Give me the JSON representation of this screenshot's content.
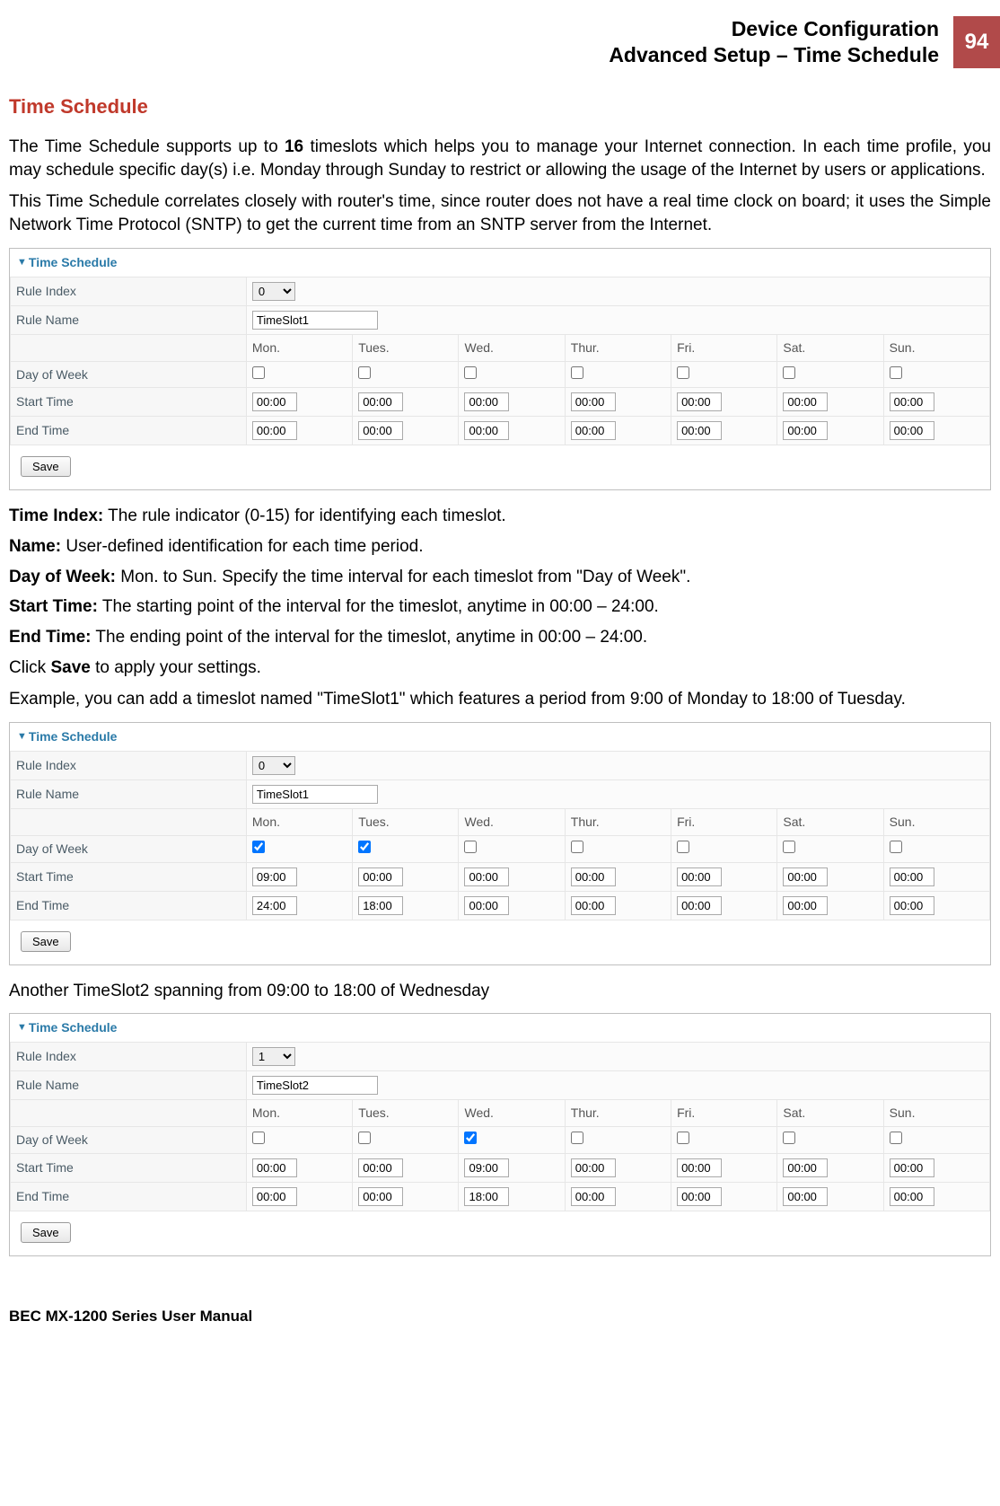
{
  "page": {
    "header_line1": "Device Configuration",
    "header_line2": "Advanced Setup – Time Schedule",
    "number": "94",
    "footer": "BEC MX-1200 Series User Manual"
  },
  "title": "Time Schedule",
  "paras": {
    "intro1_a": "The Time Schedule supports up to ",
    "intro1_b": "16",
    "intro1_c": " timeslots which helps you to manage your Internet connection. In each time profile, you may schedule specific day(s) i.e. Monday through Sunday to restrict or allowing the usage of the Internet by users or applications.",
    "intro2": "This Time Schedule correlates closely with router's time, since router does not have a real time clock on board; it uses the Simple Network Time Protocol (SNTP) to get the current time from an SNTP server from the Internet.",
    "example1": "Example, you can add a timeslot named \"TimeSlot1\" which features a period from 9:00 of Monday to 18:00 of Tuesday.",
    "example2": "Another TimeSlot2 spanning from 09:00 to 18:00 of Wednesday"
  },
  "defs": {
    "time_index_k": "Time Index:",
    "time_index_v": " The rule indicator (0-15) for identifying each timeslot.",
    "name_k": "Name:",
    "name_v": " User-defined identification for each time period.",
    "dow_k": "Day of Week:",
    "dow_v": " Mon. to Sun. Specify the time interval for each timeslot from \"Day of Week\".",
    "start_k": "Start Time:",
    "start_v": " The starting point of the interval for the timeslot, anytime in 00:00 – 24:00.",
    "end_k": "End Time:",
    "end_v": " The ending point of the interval for the timeslot, anytime in 00:00 – 24:00.",
    "click_a": "Click ",
    "click_b": "Save",
    "click_c": " to apply your settings."
  },
  "panel": {
    "title": "Time Schedule",
    "labels": {
      "rule_index": "Rule Index",
      "rule_name": "Rule Name",
      "dow": "Day of Week",
      "start": "Start Time",
      "end": "End Time",
      "save": "Save"
    },
    "days": [
      "Mon.",
      "Tues.",
      "Wed.",
      "Thur.",
      "Fri.",
      "Sat.",
      "Sun."
    ]
  },
  "panels": [
    {
      "rule_index": "0",
      "rule_name": "TimeSlot1",
      "checked": [
        false,
        false,
        false,
        false,
        false,
        false,
        false
      ],
      "start": [
        "00:00",
        "00:00",
        "00:00",
        "00:00",
        "00:00",
        "00:00",
        "00:00"
      ],
      "end": [
        "00:00",
        "00:00",
        "00:00",
        "00:00",
        "00:00",
        "00:00",
        "00:00"
      ]
    },
    {
      "rule_index": "0",
      "rule_name": "TimeSlot1",
      "checked": [
        true,
        true,
        false,
        false,
        false,
        false,
        false
      ],
      "start": [
        "09:00",
        "00:00",
        "00:00",
        "00:00",
        "00:00",
        "00:00",
        "00:00"
      ],
      "end": [
        "24:00",
        "18:00",
        "00:00",
        "00:00",
        "00:00",
        "00:00",
        "00:00"
      ]
    },
    {
      "rule_index": "1",
      "rule_name": "TimeSlot2",
      "checked": [
        false,
        false,
        true,
        false,
        false,
        false,
        false
      ],
      "start": [
        "00:00",
        "00:00",
        "09:00",
        "00:00",
        "00:00",
        "00:00",
        "00:00"
      ],
      "end": [
        "00:00",
        "00:00",
        "18:00",
        "00:00",
        "00:00",
        "00:00",
        "00:00"
      ]
    }
  ]
}
